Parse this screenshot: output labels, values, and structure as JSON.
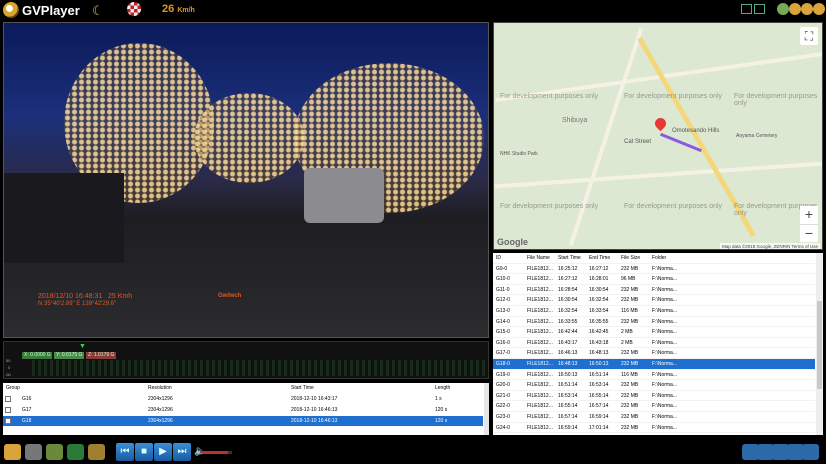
{
  "app": {
    "title": "GVPlayer",
    "speed": "26",
    "speed_unit": "Km/h"
  },
  "video": {
    "date": "2018/12/10 16:48:31",
    "speed": "25 Kmh",
    "coords": "N 35°40'2.89\"  E 139°42'29.6\"",
    "brand": "Gwitech"
  },
  "map": {
    "watermark": "For development purposes only",
    "attribution": "Map data ©2018 Google, ZENRIN   Terms of Use",
    "google": "Google",
    "places": [
      "Shibuya",
      "Omotesando Hills",
      "Cat Street",
      "NHK Studio Park",
      "Aoyama Cemetery"
    ]
  },
  "timeline": {
    "gauges": [
      {
        "label": "X: 0.0000 G",
        "color": "#3a7a3a"
      },
      {
        "label": "Y: 0.0175 G",
        "color": "#4c8a4c"
      },
      {
        "label": "Z: 1.0179 G",
        "color": "#8a3a3a"
      }
    ],
    "ticks": [
      "50",
      "0",
      "-50"
    ]
  },
  "groups": {
    "headers": [
      "Group",
      "Resolution",
      "Start Time",
      "Length"
    ],
    "rows": [
      {
        "group": "G16",
        "resolution": "2304x1296",
        "start": "2018-12-10 16:43:17",
        "length": "1 s",
        "selected": false
      },
      {
        "group": "G17",
        "resolution": "2304x1296",
        "start": "2018-12-10 16:46:13",
        "length": "120 s",
        "selected": false
      },
      {
        "group": "G18",
        "resolution": "2304x1296",
        "start": "2018-12-10 16:46:13",
        "length": "120 s",
        "selected": true
      }
    ]
  },
  "files": {
    "headers": [
      "ID",
      "File Name",
      "Start Time",
      "End Time",
      "File Size",
      "Folder"
    ],
    "rows": [
      [
        "G9-0",
        "FILE1812...",
        "16:25:12",
        "16:27:12",
        "232 MB",
        "F:\\Norma..."
      ],
      [
        "G10-0",
        "FILE1812...",
        "16:27:12",
        "16:28:01",
        "96 MB",
        "F:\\Norma..."
      ],
      [
        "G11-0",
        "FILE1812...",
        "16:28:54",
        "16:30:54",
        "232 MB",
        "F:\\Norma..."
      ],
      [
        "G12-0",
        "FILE1812...",
        "16:30:54",
        "16:32:54",
        "232 MB",
        "F:\\Norma..."
      ],
      [
        "G13-0",
        "FILE1812...",
        "16:32:54",
        "16:33:54",
        "116 MB",
        "F:\\Norma..."
      ],
      [
        "G14-0",
        "FILE1812...",
        "16:33:55",
        "16:35:55",
        "232 MB",
        "F:\\Norma..."
      ],
      [
        "G15-0",
        "FILE1812...",
        "16:42:44",
        "16:42:45",
        "2 MB",
        "F:\\Norma..."
      ],
      [
        "G16-0",
        "FILE1812...",
        "16:43:17",
        "16:43:18",
        "2 MB",
        "F:\\Norma..."
      ],
      [
        "G17-0",
        "FILE1812...",
        "16:46:13",
        "16:48:13",
        "232 MB",
        "F:\\Norma..."
      ],
      [
        "G18-0",
        "FILE1812...",
        "16:48:13",
        "16:50:13",
        "232 MB",
        "F:\\Norma..."
      ],
      [
        "G19-0",
        "FILE1812...",
        "16:50:13",
        "16:51:14",
        "116 MB",
        "F:\\Norma..."
      ],
      [
        "G20-0",
        "FILE1812...",
        "16:51:14",
        "16:53:14",
        "232 MB",
        "F:\\Norma..."
      ],
      [
        "G21-0",
        "FILE1812...",
        "16:53:14",
        "16:55:14",
        "232 MB",
        "F:\\Norma..."
      ],
      [
        "G22-0",
        "FILE1812...",
        "16:55:14",
        "16:57:14",
        "232 MB",
        "F:\\Norma..."
      ],
      [
        "G23-0",
        "FILE1812...",
        "16:57:14",
        "16:59:14",
        "232 MB",
        "F:\\Norma..."
      ],
      [
        "G24-0",
        "FILE1812...",
        "16:59:14",
        "17:01:14",
        "232 MB",
        "F:\\Norma..."
      ]
    ],
    "selected_index": 9
  },
  "colors": {
    "accent": "#1e6fcf",
    "speed": "#e09a20",
    "overlay": "#e05820"
  }
}
